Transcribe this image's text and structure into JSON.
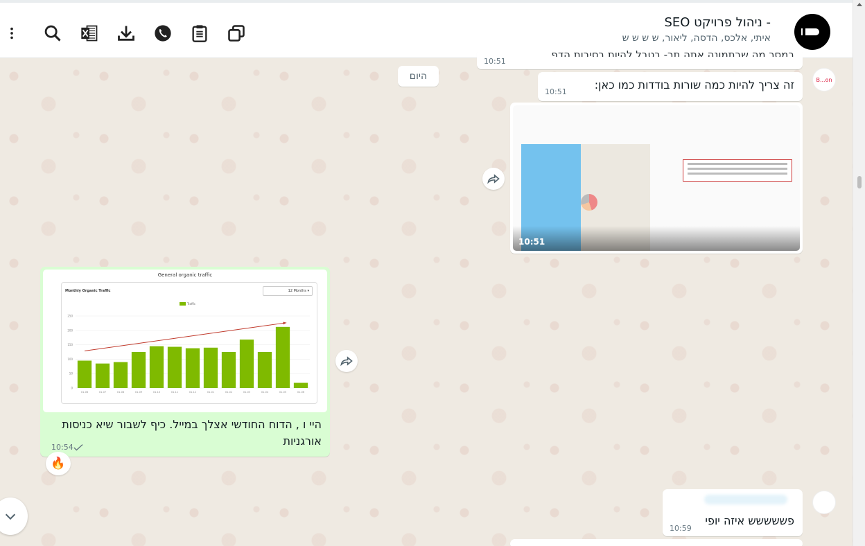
{
  "header": {
    "chat_name": "- ניהול פרויקט SEO",
    "members": "איתי, אלכס, הדסה, ליאור, ש ש ש ש"
  },
  "messages": {
    "prev_cut_text": "במסך מה שבתמונה אתה תר- בטבל להיות בסיבות הדף",
    "prev_time": "10:51",
    "date_separator": "היום",
    "msg1_text": "זה צריך להיות כמה שורות בודדות כמו כאן:",
    "msg1_time": "10:51",
    "image_time": "10:51",
    "sender_avatar_label": "B...on",
    "chart_text": "היי ו , הדוח החודשי אצלך במייל. כיף לשבור שיא כניסות אורגניות",
    "chart_time": "10:54",
    "chart_reaction": "🔥",
    "last_text": "פששששש איזה יופי",
    "last_time": "10:59"
  },
  "chart_image": {
    "title": "General organic traffic",
    "card_title": "Monthly Organic Traffic",
    "period_select": "12 Months",
    "legend": "Traffic"
  },
  "chart_data": {
    "type": "bar",
    "title": "Monthly Organic Traffic",
    "categories": [
      "01-06",
      "01-07",
      "01-08",
      "01-09",
      "01-10",
      "01-11",
      "01-12",
      "01-01",
      "01-02",
      "01-03",
      "01-04",
      "01-05",
      "01-06"
    ],
    "values": [
      95,
      85,
      90,
      125,
      145,
      143,
      138,
      140,
      125,
      168,
      125,
      212,
      18
    ],
    "yticks": [
      "250",
      "200",
      "150",
      "100",
      "50",
      "0"
    ],
    "ylim": [
      0,
      250
    ],
    "bar_color": "#7fba00",
    "trend_color": "#c0392b"
  },
  "colors": {
    "outgoing_bubble": "#d9fdd3",
    "incoming_bubble": "#ffffff",
    "wallpaper": "#efeae2"
  }
}
